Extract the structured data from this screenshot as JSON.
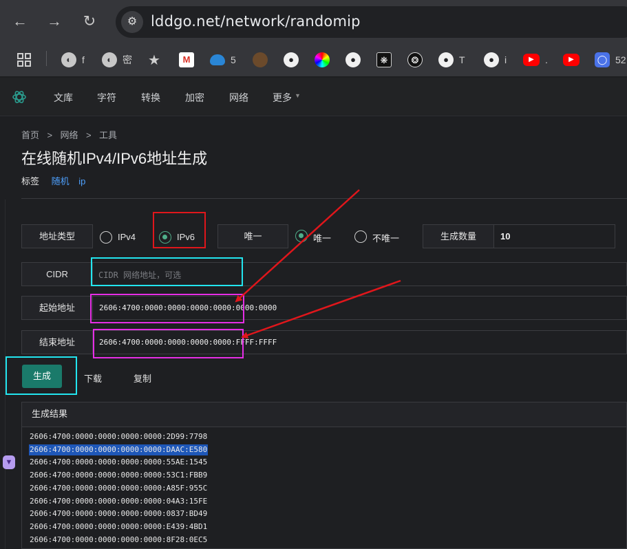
{
  "browser": {
    "url": "lddgo.net/network/randomip",
    "bookmarks": [
      {
        "icon": "globe-icon",
        "label": "f"
      },
      {
        "icon": "globe-icon",
        "label": "密"
      },
      {
        "icon": "star-icon",
        "label": ""
      },
      {
        "icon": "gmail-icon",
        "label": ""
      },
      {
        "icon": "onedrive-icon",
        "label": "5"
      },
      {
        "icon": "avatar-icon",
        "label": ""
      },
      {
        "icon": "github-icon",
        "label": ""
      },
      {
        "icon": "color-wheel-icon",
        "label": ""
      },
      {
        "icon": "github-icon",
        "label": ""
      },
      {
        "icon": "spider-icon",
        "label": ""
      },
      {
        "icon": "openai-icon",
        "label": ""
      },
      {
        "icon": "github-icon",
        "label": "T"
      },
      {
        "icon": "github-icon",
        "label": "i"
      },
      {
        "icon": "youtube-icon",
        "label": "."
      },
      {
        "icon": "youtube-icon",
        "label": ""
      },
      {
        "icon": "app-icon",
        "label": "52"
      }
    ]
  },
  "site_nav": {
    "items": [
      "文库",
      "字符",
      "转换",
      "加密",
      "网络",
      "更多"
    ]
  },
  "breadcrumb": {
    "home": "首页",
    "sep": ">",
    "network": "网络",
    "tools": "工具"
  },
  "page": {
    "title": "在线随机IPv4/IPv6地址生成",
    "tags_label": "标签",
    "tags": [
      "随机",
      "ip"
    ]
  },
  "form": {
    "address_type_label": "地址类型",
    "ipv4_label": "IPv4",
    "ipv6_label": "IPv6",
    "selected_type": "IPv6",
    "unique_group_label": "唯一",
    "unique_label": "唯一",
    "not_unique_label": "不唯一",
    "selected_unique": "唯一",
    "count_label": "生成数量",
    "count_value": "10",
    "cidr_label": "CIDR",
    "cidr_placeholder": "CIDR 网络地址，可选",
    "start_label": "起始地址",
    "start_value": "2606:4700:0000:0000:0000:0000:0000:0000",
    "end_label": "结束地址",
    "end_value": "2606:4700:0000:0000:0000:0000:FFFF:FFFF"
  },
  "actions": {
    "generate": "生成",
    "download": "下载",
    "copy": "复制"
  },
  "results": {
    "header": "生成结果",
    "lines": [
      "2606:4700:0000:0000:0000:0000:2D99:7798",
      "2606:4700:0000:0000:0000:0000:DAAC:E580",
      "2606:4700:0000:0000:0000:0000:55AE:1545",
      "2606:4700:0000:0000:0000:0000:53C1:FBB9",
      "2606:4700:0000:0000:0000:0000:A85F:955C",
      "2606:4700:0000:0000:0000:0000:04A3:15FE",
      "2606:4700:0000:0000:0000:0000:0837:BD49",
      "2606:4700:0000:0000:0000:0000:E439:4BD1",
      "2606:4700:0000:0000:0000:0000:8F28:0EC5"
    ],
    "selected_index": 1
  },
  "colors": {
    "accent": "#1a7a6a",
    "annotation_red": "#e0161b",
    "annotation_cyan": "#22e6f0",
    "annotation_magenta": "#e62ee6",
    "selection": "#1e57b8"
  }
}
